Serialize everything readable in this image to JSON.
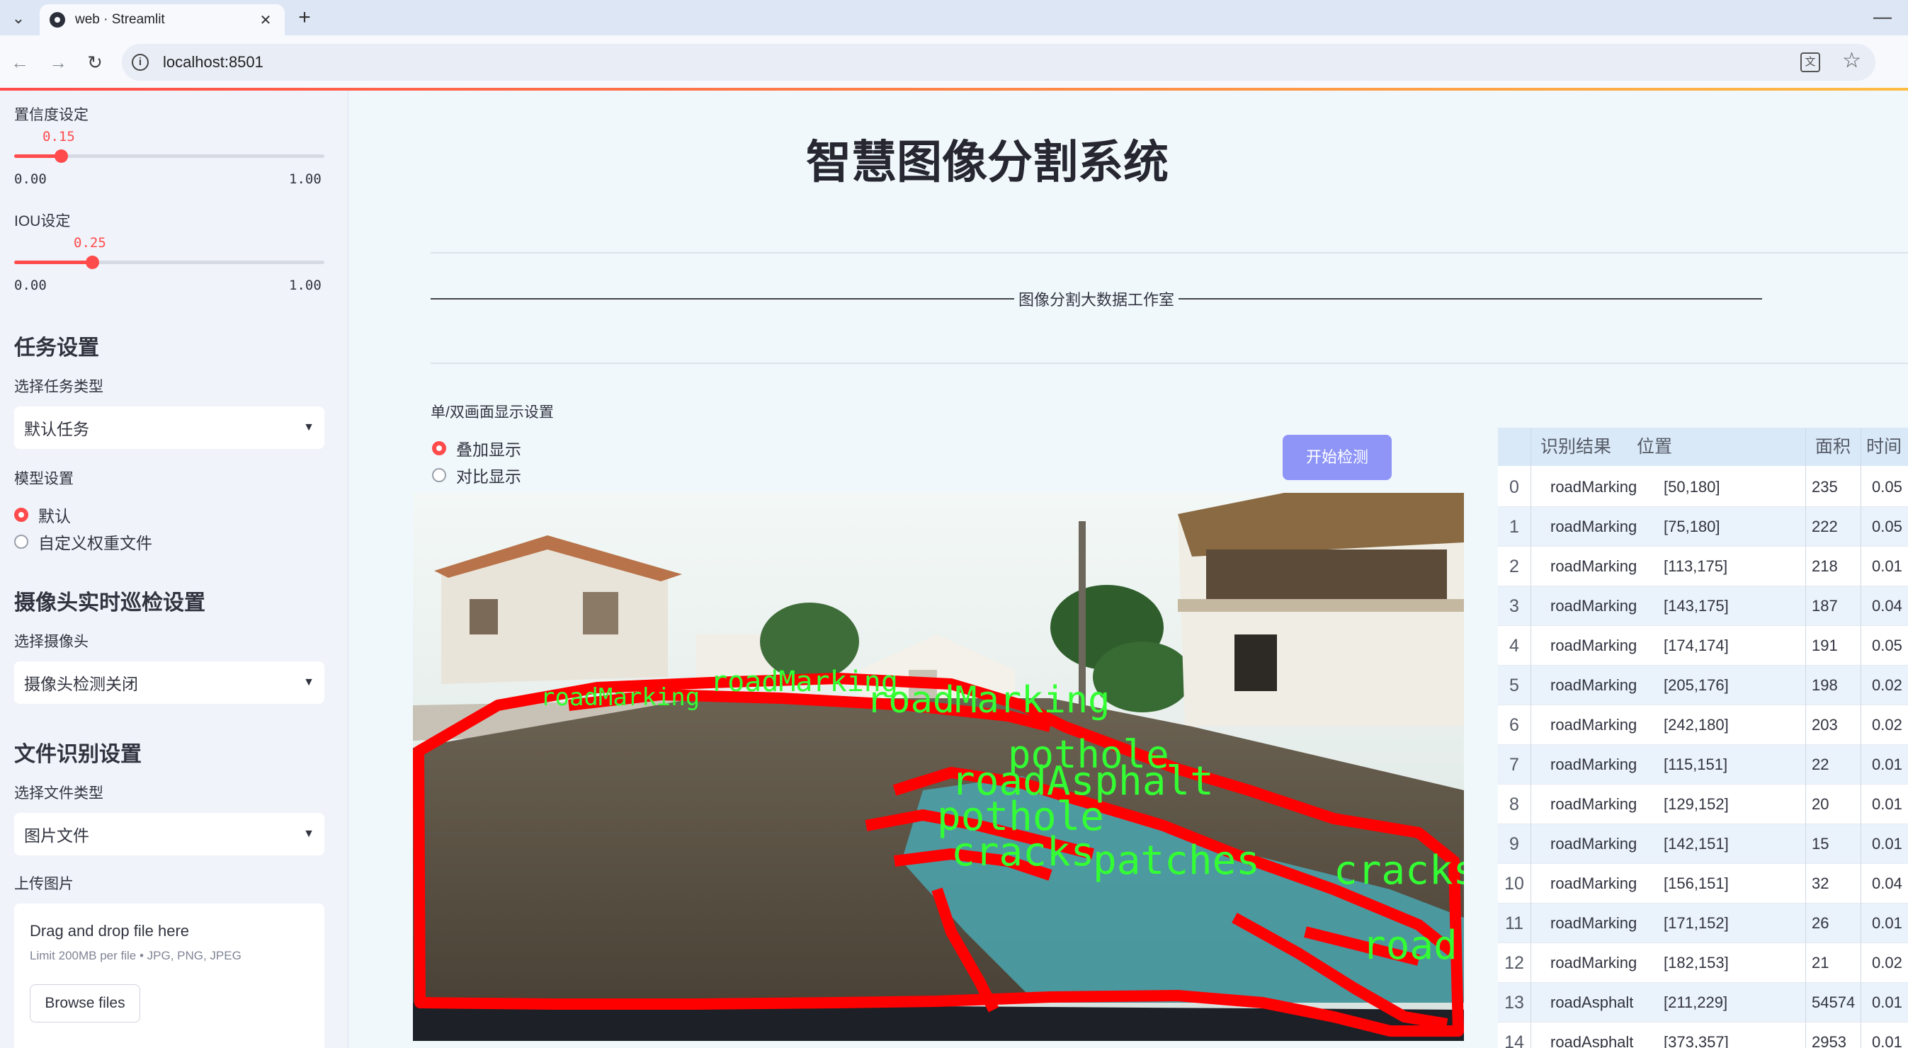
{
  "browser": {
    "tab_title": "web · Streamlit",
    "url": "localhost:8501"
  },
  "sidebar": {
    "confidence": {
      "label": "置信度设定",
      "value": "0.15",
      "fraction": 0.15,
      "min": "0.00",
      "max": "1.00"
    },
    "iou": {
      "label": "IOU设定",
      "value": "0.25",
      "fraction": 0.25,
      "min": "0.00",
      "max": "1.00"
    },
    "task": {
      "heading": "任务设置",
      "label": "选择任务类型",
      "selected": "默认任务"
    },
    "model": {
      "label": "模型设置",
      "options": [
        "默认",
        "自定义权重文件"
      ],
      "selected_index": 0
    },
    "camera": {
      "heading": "摄像头实时巡检设置",
      "label": "选择摄像头",
      "selected": "摄像头检测关闭"
    },
    "file": {
      "heading": "文件识别设置",
      "label": "选择文件类型",
      "selected": "图片文件"
    },
    "upload": {
      "label": "上传图片",
      "title": "Drag and drop file here",
      "subtitle": "Limit 200MB per file • JPG, PNG, JPEG",
      "button": "Browse files"
    }
  },
  "main": {
    "title": "智慧图像分割系统",
    "studio": "图像分割大数据工作室",
    "display_label": "单/双画面显示设置",
    "display_options": [
      "叠加显示",
      "对比显示"
    ],
    "display_selected": 0,
    "start_button": "开始检测",
    "overlay_labels": [
      "roadMarking",
      "roadMarking",
      "roadMarking",
      "pothole",
      "roadAsphalt",
      "pothole",
      "cracks",
      "patches",
      "cracks",
      "road"
    ]
  },
  "table": {
    "headers": [
      "识别结果",
      "位置",
      "面积",
      "时间"
    ],
    "rows": [
      {
        "idx": "0",
        "result": "roadMarking",
        "pos": "[50,180]",
        "area": "235",
        "time": "0.05"
      },
      {
        "idx": "1",
        "result": "roadMarking",
        "pos": "[75,180]",
        "area": "222",
        "time": "0.05"
      },
      {
        "idx": "2",
        "result": "roadMarking",
        "pos": "[113,175]",
        "area": "218",
        "time": "0.01"
      },
      {
        "idx": "3",
        "result": "roadMarking",
        "pos": "[143,175]",
        "area": "187",
        "time": "0.04"
      },
      {
        "idx": "4",
        "result": "roadMarking",
        "pos": "[174,174]",
        "area": "191",
        "time": "0.05"
      },
      {
        "idx": "5",
        "result": "roadMarking",
        "pos": "[205,176]",
        "area": "198",
        "time": "0.02"
      },
      {
        "idx": "6",
        "result": "roadMarking",
        "pos": "[242,180]",
        "area": "203",
        "time": "0.02"
      },
      {
        "idx": "7",
        "result": "roadMarking",
        "pos": "[115,151]",
        "area": "22",
        "time": "0.01"
      },
      {
        "idx": "8",
        "result": "roadMarking",
        "pos": "[129,152]",
        "area": "20",
        "time": "0.01"
      },
      {
        "idx": "9",
        "result": "roadMarking",
        "pos": "[142,151]",
        "area": "15",
        "time": "0.01"
      },
      {
        "idx": "10",
        "result": "roadMarking",
        "pos": "[156,151]",
        "area": "32",
        "time": "0.04"
      },
      {
        "idx": "11",
        "result": "roadMarking",
        "pos": "[171,152]",
        "area": "26",
        "time": "0.01"
      },
      {
        "idx": "12",
        "result": "roadMarking",
        "pos": "[182,153]",
        "area": "21",
        "time": "0.02"
      },
      {
        "idx": "13",
        "result": "roadAsphalt",
        "pos": "[211,229]",
        "area": "54574",
        "time": "0.01"
      },
      {
        "idx": "14",
        "result": "roadAsphalt",
        "pos": "[373,357]",
        "area": "2953",
        "time": "0.01"
      }
    ]
  },
  "colors": {
    "accent": "#ff4b4b",
    "button": "#8e95f7",
    "mask_outline": "#ff0000",
    "mask_label": "#33ff33"
  },
  "icons": [
    "tab-list-icon",
    "streamlit-favicon",
    "close-icon",
    "plus-icon",
    "minimize-icon",
    "back-icon",
    "forward-icon",
    "reload-icon",
    "info-icon",
    "translate-icon",
    "star-icon",
    "chevron-down-icon"
  ]
}
